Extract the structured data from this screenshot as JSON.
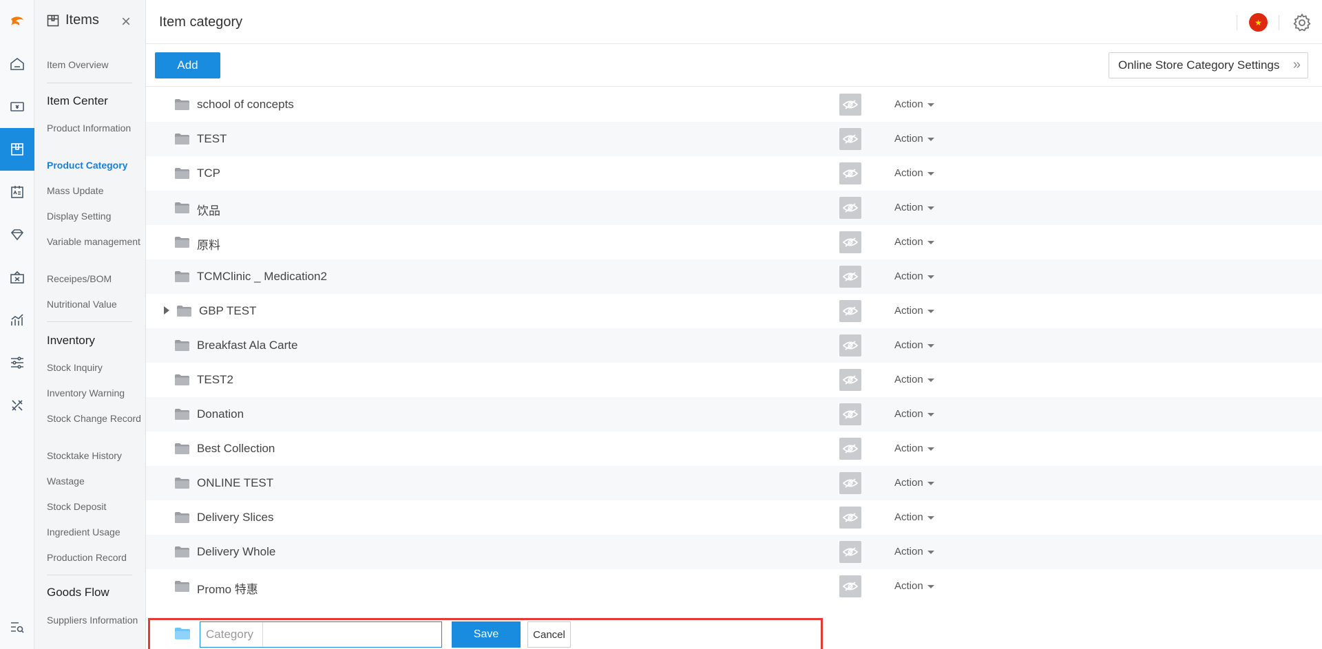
{
  "app": {
    "module_title": "Items",
    "page_title": "Item category"
  },
  "colors": {
    "accent": "#1a8cdf",
    "highlight_border": "#e53935"
  },
  "rail": {
    "icons": [
      "logo-icon",
      "home-icon",
      "billing-icon",
      "items-icon",
      "member-card-icon",
      "diamond-icon",
      "promotion-icon",
      "analytics-icon",
      "settings-sliders-icon",
      "tools-icon",
      "search-list-icon"
    ]
  },
  "subnav": {
    "item_overview": "Item Overview",
    "item_center": {
      "title": "Item Center",
      "items": [
        "Product Information",
        "Product Category",
        "Mass Update",
        "Display Setting",
        "Variable management",
        "Receipes/BOM",
        "Nutritional Value"
      ],
      "active": "Product Category"
    },
    "inventory": {
      "title": "Inventory",
      "items": [
        "Stock Inquiry",
        "Inventory Warning",
        "Stock Change Record",
        "Stocktake History",
        "Wastage",
        "Stock Deposit",
        "Ingredient Usage",
        "Production Record"
      ]
    },
    "goods_flow": {
      "title": "Goods Flow",
      "items": [
        "Suppliers Information"
      ]
    }
  },
  "toolbar": {
    "add_label": "Add",
    "online_store_label": "Online Store Category Settings"
  },
  "categories": [
    {
      "name": "school of concepts",
      "action": "Action",
      "expandable": false
    },
    {
      "name": "TEST",
      "action": "Action",
      "expandable": false
    },
    {
      "name": "TCP",
      "action": "Action",
      "expandable": false
    },
    {
      "name": "饮品",
      "action": "Action",
      "expandable": false
    },
    {
      "name": "原料",
      "action": "Action",
      "expandable": false
    },
    {
      "name": "TCMClinic _ Medication2",
      "action": "Action",
      "expandable": false
    },
    {
      "name": "GBP TEST",
      "action": "Action",
      "expandable": true
    },
    {
      "name": "Breakfast Ala Carte",
      "action": "Action",
      "expandable": false
    },
    {
      "name": "TEST2",
      "action": "Action",
      "expandable": false
    },
    {
      "name": "Donation",
      "action": "Action",
      "expandable": false
    },
    {
      "name": "Best Collection",
      "action": "Action",
      "expandable": false
    },
    {
      "name": "ONLINE TEST",
      "action": "Action",
      "expandable": false
    },
    {
      "name": "Delivery Slices",
      "action": "Action",
      "expandable": false
    },
    {
      "name": "Delivery Whole",
      "action": "Action",
      "expandable": false
    },
    {
      "name": "Promo 特惠",
      "action": "Action",
      "expandable": false
    }
  ],
  "new_category": {
    "label": "Category",
    "value": "",
    "save_label": "Save",
    "cancel_label": "Cancel"
  }
}
